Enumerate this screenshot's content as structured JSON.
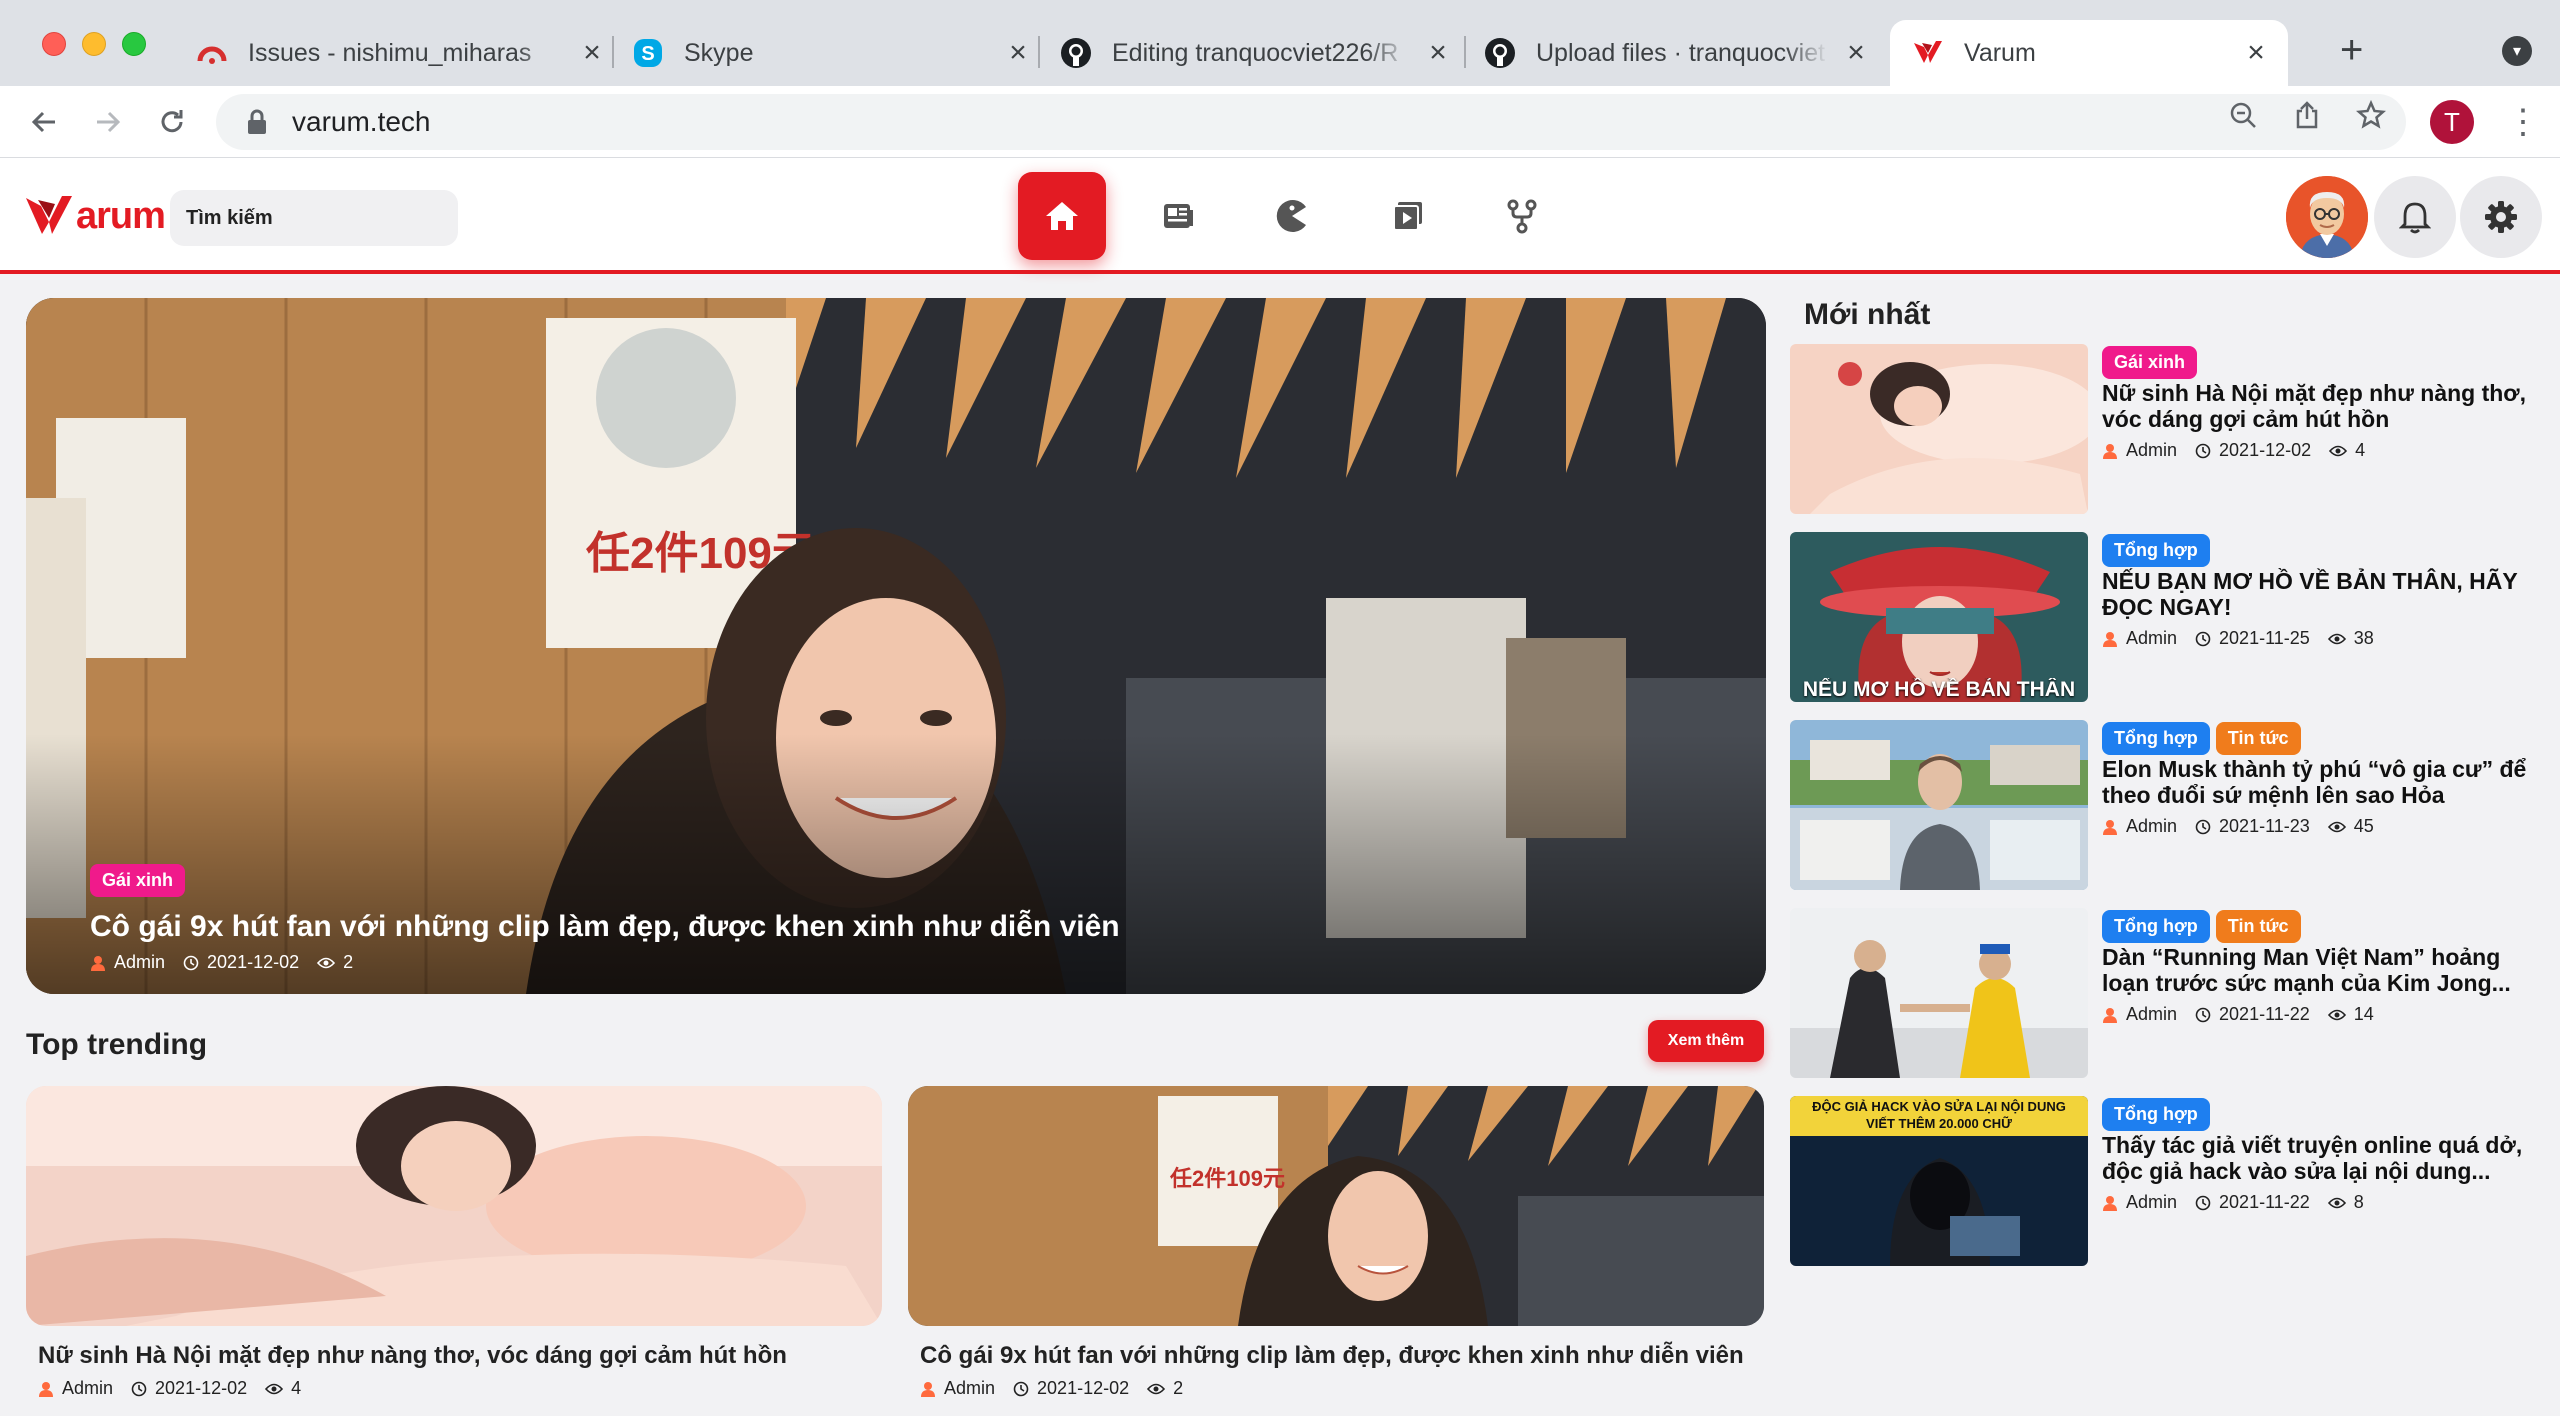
{
  "browser": {
    "tabs": [
      {
        "title": "Issues - nishimu_miharas",
        "icon": "ubuntu-favicon"
      },
      {
        "title": "Skype",
        "icon": "skype-favicon"
      },
      {
        "title": "Editing tranquocviet226/R",
        "icon": "github-favicon"
      },
      {
        "title": "Upload files · tranquocviet",
        "icon": "github-favicon"
      },
      {
        "title": "Varum",
        "icon": "varum-favicon",
        "active": true
      }
    ],
    "url": "varum.tech",
    "profile_initial": "T"
  },
  "site": {
    "logo_text": "arum",
    "search_placeholder": "Tìm kiếm",
    "nav": [
      "home-icon",
      "news-icon",
      "pacman-icon",
      "video-icon",
      "fork-icon"
    ],
    "accent": "#e31b23"
  },
  "hero": {
    "category": "Gái xinh",
    "title": "Cô gái 9x hút fan với những clip làm đẹp, được khen xinh như diễn viên",
    "author": "Admin",
    "date": "2021-12-02",
    "views": "2"
  },
  "trending": {
    "title": "Top trending",
    "see_more": "Xem thêm",
    "items": [
      {
        "title": "Nữ sinh Hà Nội mặt đẹp như nàng thơ, vóc dáng gợi cảm hút hồn",
        "author": "Admin",
        "date": "2021-12-02",
        "views": "4"
      },
      {
        "title": "Cô gái 9x hút fan với những clip làm đẹp, được khen xinh như diễn viên",
        "author": "Admin",
        "date": "2021-12-02",
        "views": "2"
      }
    ]
  },
  "latest": {
    "title": "Mới nhất",
    "items": [
      {
        "tags": [
          "Gái xinh"
        ],
        "title": "Nữ sinh Hà Nội mặt đẹp như nàng thơ, vóc dáng gợi cảm hút hồn",
        "author": "Admin",
        "date": "2021-12-02",
        "views": "4"
      },
      {
        "tags": [
          "Tổng hợp"
        ],
        "title": "NẾU BẠN MƠ HỒ VỀ BẢN THÂN, HÃY ĐỌC NGAY!",
        "author": "Admin",
        "date": "2021-11-25",
        "views": "38",
        "thumb_caption": "NẾU MƠ HỒ VỀ BẢN THÂN"
      },
      {
        "tags": [
          "Tổng hợp",
          "Tin tức"
        ],
        "title": "Elon Musk thành tỷ phú “vô gia cư” để theo đuổi sứ mệnh lên sao Hỏa",
        "author": "Admin",
        "date": "2021-11-23",
        "views": "45"
      },
      {
        "tags": [
          "Tổng hợp",
          "Tin tức"
        ],
        "title": "Dàn “Running Man Việt Nam” hoảng loạn trước sức mạnh của Kim Jong...",
        "author": "Admin",
        "date": "2021-11-22",
        "views": "14"
      },
      {
        "tags": [
          "Tổng hợp"
        ],
        "title": "Thấy tác giả viết truyện online quá dở, độc giả hack vào sửa lại nội dung...",
        "author": "Admin",
        "date": "2021-11-22",
        "views": "8",
        "thumb_caption": "ĐỘC GIẢ HACK VÀO SỬA LẠI NỘI DUNG VIẾT THÊM 20.000 CHỮ"
      }
    ]
  }
}
